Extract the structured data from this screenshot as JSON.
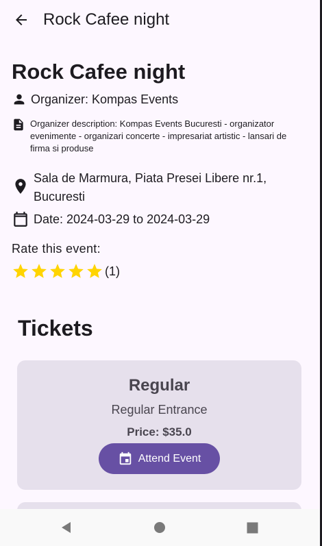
{
  "app_bar": {
    "title": "Rock Cafee night",
    "back_icon": "arrow-back-icon"
  },
  "event": {
    "title": "Rock Cafee night",
    "organizer": "Organizer: Kompas Events",
    "organizer_description": "Organizer description: Kompas Events Bucuresti - organizator evenimente - organizari concerte - impresariat artistic - lansari de firma si produse",
    "location": "Sala de Marmura, Piata Presei Libere nr.1, Bucuresti",
    "date": "Date: 2024-03-29 to 2024-03-29",
    "icons": {
      "organizer": "person-icon",
      "description": "document-icon",
      "location": "location-pin-icon",
      "date": "calendar-icon"
    }
  },
  "rating": {
    "label": "Rate this event:",
    "stars_filled": 5,
    "stars_total": 5,
    "count": "(1)",
    "star_color": "#ffd400"
  },
  "tickets": {
    "heading": "Tickets",
    "items": [
      {
        "name": "Regular",
        "description": "Regular Entrance",
        "price": "Price: $35.0",
        "button_label": "Attend Event",
        "button_icon": "event-icon"
      }
    ]
  },
  "colors": {
    "background": "#fdf7ff",
    "card": "#e6e0ec",
    "primary": "#6750a4",
    "text": "#1d1b20",
    "muted_text": "#49454f"
  },
  "system_nav": {
    "icons": [
      "nav-back-icon",
      "nav-home-icon",
      "nav-recents-icon"
    ]
  }
}
